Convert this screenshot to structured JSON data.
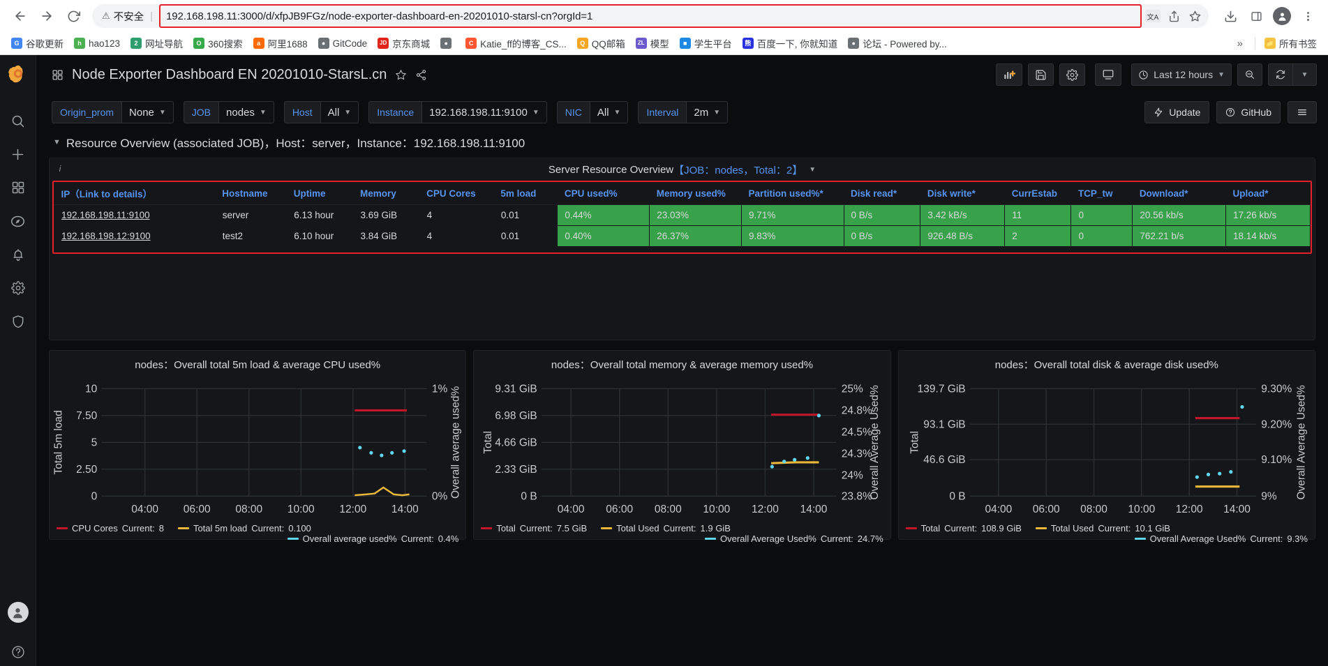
{
  "browser": {
    "back_icon": "back-arrow-icon",
    "forward_icon": "forward-arrow-icon",
    "reload_icon": "reload-icon",
    "security_label": "不安全",
    "url_scheme_hidden": "",
    "url": "192.168.198.11:3000/d/xfpJB9FGz/node-exporter-dashboard-en-20201010-starsl-cn?orgId=1",
    "url_host": "192.168.198.11",
    "url_rest": ":3000/d/xfpJB9FGz/node-exporter-dashboard-en-20201010-starsl-cn?orgId=1",
    "translate_icon": "translate-icon",
    "share_icon": "share-icon",
    "star_icon": "star-icon",
    "download_icon": "download-icon",
    "sidepanel_icon": "side-panel-icon",
    "profile_icon": "profile-icon",
    "menu_icon": "three-dot-menu-icon",
    "bookmarks": [
      {
        "label": "谷歌更新",
        "icon": "chrome-icon",
        "color": "#4285f4",
        "glyph": "G"
      },
      {
        "label": "hao123",
        "icon": "hao123-icon",
        "color": "#4caf50",
        "glyph": "h"
      },
      {
        "label": "网址导航",
        "icon": "navigation-icon",
        "color": "#2f9e6e",
        "glyph": "2"
      },
      {
        "label": "360搜索",
        "icon": "360-search-icon",
        "color": "#36a94a",
        "glyph": "O"
      },
      {
        "label": "阿里1688",
        "icon": "alibaba-icon",
        "color": "#ff6a00",
        "glyph": "a"
      },
      {
        "label": "GitCode",
        "icon": "globe-icon",
        "color": "#6b7075",
        "glyph": "●"
      },
      {
        "label": "京东商城",
        "icon": "jd-icon",
        "color": "#e1251b",
        "glyph": "JD"
      },
      {
        "label": "",
        "icon": "globe-icon",
        "color": "#6b7075",
        "glyph": "●"
      },
      {
        "label": "Katie_ff的博客_CS...",
        "icon": "csdn-icon",
        "color": "#fc5531",
        "glyph": "C"
      },
      {
        "label": "QQ邮箱",
        "icon": "qq-mail-icon",
        "color": "#f5a623",
        "glyph": "Q"
      },
      {
        "label": "模型",
        "icon": "zl-model-icon",
        "color": "#6a5acd",
        "glyph": "ZL"
      },
      {
        "label": "学生平台",
        "icon": "student-platform-icon",
        "color": "#1e88e5",
        "glyph": "■"
      },
      {
        "label": "百度一下, 你就知道",
        "icon": "baidu-icon",
        "color": "#2932e1",
        "glyph": "熊"
      },
      {
        "label": "论坛 - Powered by...",
        "icon": "globe-icon",
        "color": "#6b7075",
        "glyph": "●"
      }
    ],
    "overflow_label": "»",
    "all_bookmarks_label": "所有书签",
    "all_bookmarks_icon": "folder-icon"
  },
  "sidebar": {
    "logo_icon": "grafana-logo-icon",
    "items": [
      {
        "icon": "search-icon",
        "name": "search"
      },
      {
        "icon": "plus-icon",
        "name": "create"
      },
      {
        "icon": "dashboards-icon",
        "name": "dashboards"
      },
      {
        "icon": "compass-explore-icon",
        "name": "explore"
      },
      {
        "icon": "bell-alerting-icon",
        "name": "alerting"
      },
      {
        "icon": "gear-configuration-icon",
        "name": "configuration"
      },
      {
        "icon": "shield-admin-icon",
        "name": "server-admin"
      }
    ],
    "avatar_icon": "user-avatar-icon",
    "help_icon": "help-question-icon"
  },
  "dashboard_nav": {
    "grid_icon": "dashboard-grid-icon",
    "title": "Node Exporter Dashboard EN 20201010-StarsL.cn",
    "star_icon": "star-favorite-icon",
    "share_icon": "share-dashboard-icon",
    "add_panel_icon": "add-panel-icon",
    "save_icon": "save-dashboard-icon",
    "settings_icon": "dashboard-settings-icon",
    "tv_icon": "cycle-view-mode-icon",
    "time_picker_icon": "clock-icon",
    "time_range": "Last 12 hours",
    "time_chevron": "chevron-down-icon",
    "zoom_out_icon": "zoom-out-time-range-icon",
    "refresh_icon": "refresh-icon",
    "refresh_chevron": "chevron-down-icon"
  },
  "variables": [
    {
      "label": "Origin_prom",
      "value": "None",
      "has_chevron": true
    },
    {
      "label": "JOB",
      "value": "nodes",
      "has_chevron": true
    },
    {
      "label": "Host",
      "value": "All",
      "has_chevron": true
    },
    {
      "label": "Instance",
      "value": "192.168.198.11:9100",
      "has_chevron": true
    },
    {
      "label": "NIC",
      "value": "All",
      "has_chevron": true
    },
    {
      "label": "Interval",
      "value": "2m",
      "has_chevron": true
    }
  ],
  "var_actions": {
    "update_label": "Update",
    "update_icon": "lightning-bolt-icon",
    "github_label": "GitHub",
    "github_icon": "question-circle-icon",
    "menu_icon": "hamburger-menu-icon"
  },
  "row": {
    "chevron_icon": "chevron-down-icon",
    "title": "Resource Overview (associated JOB)，Host：server，Instance：192.168.198.11:9100"
  },
  "table_panel": {
    "info_icon": "panel-info-icon",
    "title_main": "Server Resource Overview",
    "title_detail": "【JOB：nodes，Total：2】",
    "menu_chevron": "chevron-down-icon",
    "columns": [
      "IP（Link to details）",
      "Hostname",
      "Uptime",
      "Memory",
      "CPU Cores",
      "5m load",
      "CPU used%",
      "Memory used%",
      "Partition used%*",
      "Disk read*",
      "Disk write*",
      "CurrEstab",
      "TCP_tw",
      "Download*",
      "Upload*"
    ],
    "rows": [
      {
        "ip": "192.168.198.11:9100",
        "hostname": "server",
        "uptime": "6.13 hour",
        "memory": "3.69 GiB",
        "cpu_cores": "4",
        "load5m": "0.01",
        "cpu_used": "0.44%",
        "memory_used": "23.03%",
        "partition_used": "9.71%",
        "disk_read": "0 B/s",
        "disk_write": "3.42 kB/s",
        "currestab": "11",
        "tcp_tw": "0",
        "download": "20.56 kb/s",
        "upload": "17.26 kb/s"
      },
      {
        "ip": "192.168.198.12:9100",
        "hostname": "test2",
        "uptime": "6.10 hour",
        "memory": "3.84 GiB",
        "cpu_cores": "4",
        "load5m": "0.01",
        "cpu_used": "0.40%",
        "memory_used": "26.37%",
        "partition_used": "9.83%",
        "disk_read": "0 B/s",
        "disk_write": "926.48 B/s",
        "currestab": "2",
        "tcp_tw": "0",
        "download": "762.21 b/s",
        "upload": "18.14 kb/s"
      }
    ],
    "colors": {
      "header_text": "#5794f2",
      "cell_green": "#37a24a",
      "highlight_border": "#e8202a"
    }
  },
  "chart_data": [
    {
      "type": "line",
      "title": "nodes：Overall total 5m load & average CPU used%",
      "xlabel": "",
      "ylabel": "Total 5m load",
      "y2label": "Overall average used%",
      "x": [
        "04:00",
        "06:00",
        "08:00",
        "10:00",
        "12:00",
        "14:00"
      ],
      "ylim": [
        0,
        10
      ],
      "yticks": [
        "0",
        "2.50",
        "5",
        "7.50",
        "10"
      ],
      "y2lim": [
        0,
        1
      ],
      "y2ticks": [
        "0%",
        "1%"
      ],
      "grid": true,
      "legend_position": "bottom",
      "series": [
        {
          "name": "CPU Cores",
          "color": "#c4162a",
          "current": "8",
          "points": [
            [
              12.4,
              8.0
            ],
            [
              14.6,
              8.0
            ]
          ]
        },
        {
          "name": "Total 5m load",
          "color": "#eab839",
          "current": "0.100",
          "points": [
            [
              12.4,
              0.05
            ],
            [
              12.8,
              0.06
            ],
            [
              13.1,
              0.08
            ],
            [
              13.4,
              0.55
            ],
            [
              13.8,
              0.12
            ],
            [
              14.2,
              0.1
            ],
            [
              14.6,
              0.12
            ]
          ]
        },
        {
          "name": "Overall average used%",
          "color": "#5fd7f0",
          "current": "0.4%",
          "points": [
            [
              12.6,
              4.45
            ],
            [
              13.0,
              4.0
            ],
            [
              13.4,
              3.75
            ],
            [
              13.8,
              3.95
            ],
            [
              14.3,
              4.15
            ]
          ]
        }
      ]
    },
    {
      "type": "line",
      "title": "nodes：Overall total memory & average memory used%",
      "xlabel": "",
      "ylabel": "Total",
      "y2label": "Overall Average Used%",
      "x": [
        "04:00",
        "06:00",
        "08:00",
        "10:00",
        "12:00",
        "14:00"
      ],
      "ylim": [
        0,
        9.31
      ],
      "yticks": [
        "0 B",
        "2.33 GiB",
        "4.66 GiB",
        "6.98 GiB",
        "9.31 GiB"
      ],
      "y2ticks": [
        "23.8%",
        "24%",
        "24.3%",
        "24.5%",
        "24.8%",
        "25%"
      ],
      "grid": true,
      "legend_position": "bottom",
      "series": [
        {
          "name": "Total",
          "color": "#c4162a",
          "current": "7.5 GiB",
          "points": [
            [
              12.4,
              7.5
            ],
            [
              14.4,
              7.5
            ]
          ]
        },
        {
          "name": "Total Used",
          "color": "#eab839",
          "current": "1.9 GiB",
          "points": [
            [
              12.4,
              1.9
            ],
            [
              13.2,
              1.92
            ],
            [
              14.4,
              1.95
            ]
          ]
        },
        {
          "name": "Overall Average Used%",
          "color": "#5fd7f0",
          "current": "24.7%",
          "points": [
            [
              12.4,
              1.72
            ],
            [
              12.9,
              1.99
            ],
            [
              13.4,
              2.06
            ],
            [
              14.0,
              2.2
            ]
          ]
        }
      ]
    },
    {
      "type": "line",
      "title": "nodes：Overall total disk & average disk used%",
      "xlabel": "",
      "ylabel": "Total",
      "y2label": "Overall Average Used%",
      "x": [
        "04:00",
        "06:00",
        "08:00",
        "10:00",
        "12:00",
        "14:00"
      ],
      "ylim": [
        0,
        139.7
      ],
      "yticks": [
        "0 B",
        "46.6 GiB",
        "93.1 GiB",
        "139.7 GiB"
      ],
      "y2ticks": [
        "9%",
        "9.10%",
        "9.20%",
        "9.30%"
      ],
      "grid": true,
      "legend_position": "bottom",
      "series": [
        {
          "name": "Total",
          "color": "#c4162a",
          "current": "108.9 GiB",
          "points": [
            [
              12.35,
              108.9
            ],
            [
              14.1,
              108.9
            ]
          ]
        },
        {
          "name": "Total Used",
          "color": "#eab839",
          "current": "10.1 GiB",
          "points": [
            [
              12.35,
              10.1
            ],
            [
              14.1,
              10.1
            ]
          ]
        },
        {
          "name": "Overall Average Used%",
          "color": "#5fd7f0",
          "current": "9.3%",
          "points": [
            [
              12.3,
              26.0
            ],
            [
              12.8,
              28.0
            ],
            [
              13.3,
              29.5
            ],
            [
              13.9,
              31.0
            ],
            [
              14.5,
              125.0
            ]
          ]
        }
      ]
    }
  ],
  "legends": {
    "current_word": "Current:"
  }
}
